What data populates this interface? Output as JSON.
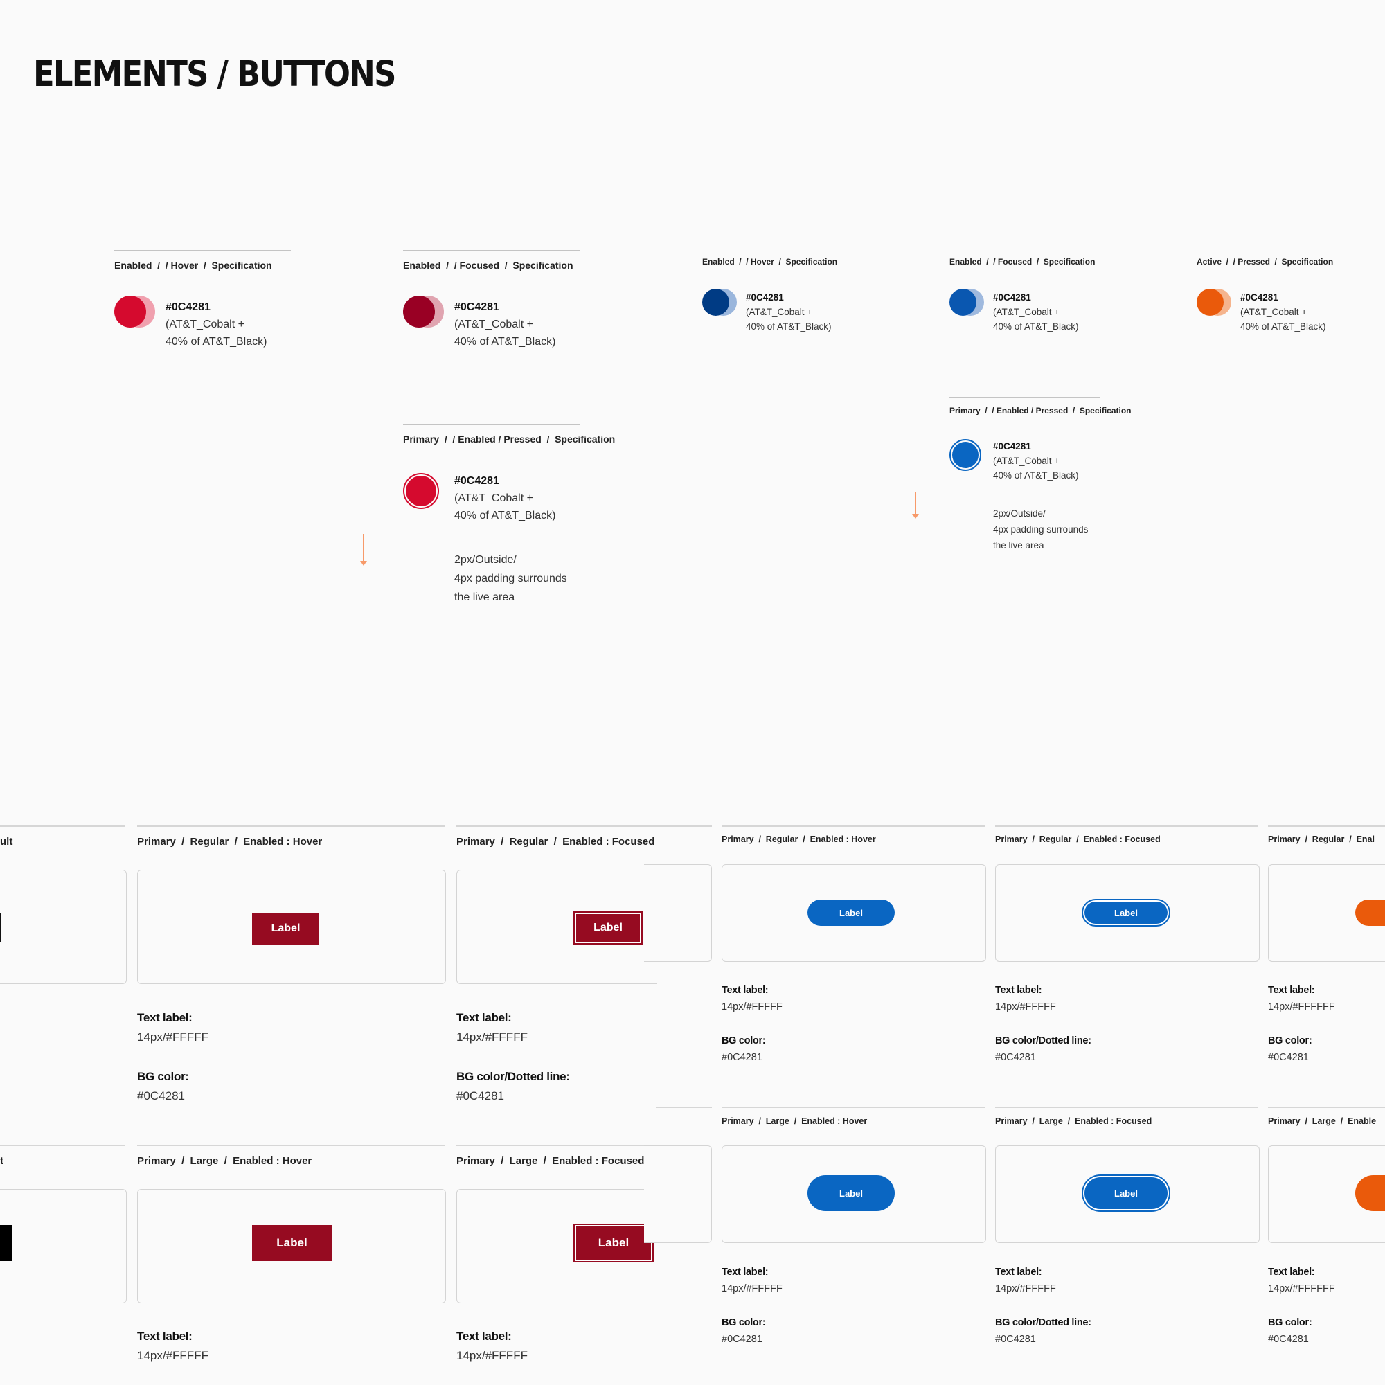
{
  "page": {
    "title": "ELEMENTS / BUTTONS"
  },
  "specs": [
    {
      "parts": [
        "Enabled",
        "/ Hover",
        "Specification"
      ],
      "hex": "#0C4281",
      "line2": "(AT&T_Cobalt +",
      "line3": "40% of AT&T_Black)",
      "swatch": "#d50a2e",
      "ring": "#f0a0ae"
    },
    {
      "parts": [
        "Enabled",
        "/ Focused",
        "Specification"
      ],
      "hex": "#0C4281",
      "line2": "(AT&T_Cobalt +",
      "line3": "40% of AT&T_Black)",
      "swatch": "#990024",
      "ring": "#e0a4b0"
    },
    {
      "parts": [
        "Primary",
        "/ Enabled / Pressed",
        "Specification"
      ],
      "hex": "#0C4281",
      "line2": "(AT&T_Cobalt +",
      "line3": "40% of AT&T_Black)",
      "swatch": "#d50a2e",
      "ring": "#d50a2e",
      "note": [
        "2px/Outside/",
        "4px padding surrounds",
        "the live area"
      ]
    },
    {
      "parts": [
        "Enabled",
        "/ Hover",
        "Specification"
      ],
      "hex": "#0C4281",
      "line2": "(AT&T_Cobalt +",
      "line3": "40% of AT&T_Black)",
      "swatch": "#003b84",
      "ring": "#9ab6dc"
    },
    {
      "parts": [
        "Enabled",
        "/ Focused",
        "Specification"
      ],
      "hex": "#0C4281",
      "line2": "(AT&T_Cobalt +",
      "line3": "40% of AT&T_Black)",
      "swatch": "#0a57b0",
      "ring": "#9fb9de"
    },
    {
      "parts": [
        "Active",
        "/ Pressed",
        "Specification"
      ],
      "hex": "#0C4281",
      "line2": "(AT&T_Cobalt +",
      "line3": "40% of AT&T_Black)",
      "swatch": "#ea5a0b",
      "ring": "#f5b48d"
    },
    {
      "parts": [
        "Primary",
        "/ Enabled / Pressed",
        "Specification"
      ],
      "hex": "#0C4281",
      "line2": "(AT&T_Cobalt +",
      "line3": "40% of AT&T_Black)",
      "swatch": "#0a66c2",
      "ring": "#0a66c2",
      "note": [
        "2px/Outside/",
        "4px padding surrounds",
        "the live area"
      ]
    }
  ],
  "cells": [
    {
      "header": [
        "ult"
      ],
      "t1": "",
      "t2": "",
      "t3": "",
      "t4": ""
    },
    {
      "header": [
        "Primary",
        "Regular",
        "Enabled : Hover"
      ],
      "button": "Label",
      "t1": "Text label:",
      "t2": "14px/#FFFFF",
      "t3": "BG color:",
      "t4": "#0C4281"
    },
    {
      "header": [
        "Primary",
        "Regular",
        "Enabled : Focused"
      ],
      "button": "Label",
      "t1": "Text label:",
      "t2": "14px/#FFFFF",
      "t3": "BG color/Dotted line:",
      "t4": "#0C4281"
    },
    {
      "header": [
        "t"
      ],
      "t1": "",
      "t2": "",
      "t3": "",
      "t4": ""
    },
    {
      "header": [
        "Primary",
        "Large",
        "Enabled : Hover"
      ],
      "button": "Label",
      "t1": "Text label:",
      "t2": "14px/#FFFFF"
    },
    {
      "header": [
        "Primary",
        "Large",
        "Enabled : Focused"
      ],
      "button": "Label",
      "t1": "Text label:",
      "t2": "14px/#FFFFF"
    },
    {
      "header": [
        "Primary",
        "Regular",
        "Enabled : Hover"
      ],
      "button": "Label",
      "t1": "Text label:",
      "t2": "14px/#FFFFF",
      "t3": "BG color:",
      "t4": "#0C4281"
    },
    {
      "header": [
        "Primary",
        "Regular",
        "Enabled : Focused"
      ],
      "button": "Label",
      "t1": "Text label:",
      "t2": "14px/#FFFFF",
      "t3": "BG color/Dotted line:",
      "t4": "#0C4281"
    },
    {
      "header": [
        "Primary",
        "Regular",
        "Enal"
      ],
      "t1": "Text label:",
      "t2": "14px/#FFFFFF",
      "t3": "BG color:",
      "t4": "#0C4281"
    },
    {
      "header": [
        "Primary",
        "Large",
        "Enabled : Hover"
      ],
      "button": "Label",
      "t1": "Text label:",
      "t2": "14px/#FFFFF",
      "t3": "BG color:",
      "t4": "#0C4281"
    },
    {
      "header": [
        "Primary",
        "Large",
        "Enabled : Focused"
      ],
      "button": "Label",
      "t1": "Text label:",
      "t2": "14px/#FFFFF",
      "t3": "BG color/Dotted line:",
      "t4": "#0C4281"
    },
    {
      "header": [
        "Primary",
        "Large",
        "Enable"
      ],
      "t1": "Text label:",
      "t2": "14px/#FFFFFF",
      "t3": "BG color:",
      "t4": "#0C4281"
    }
  ],
  "colors": {
    "red": "#960b21",
    "blue": "#0a66c2",
    "orange": "#ea5a0b",
    "black": "#000000"
  }
}
